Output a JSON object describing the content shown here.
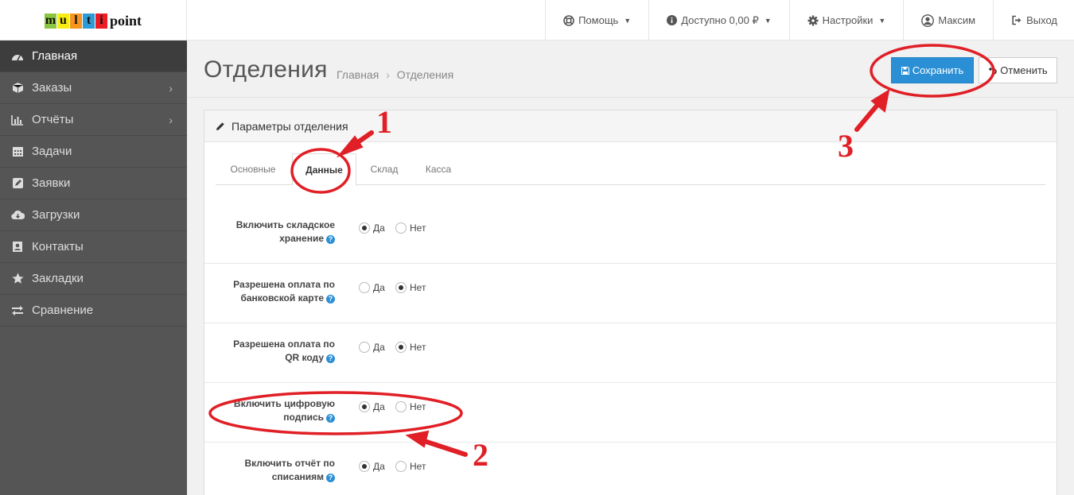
{
  "logo": {
    "letters": [
      "m",
      "u",
      "l",
      "t",
      "i"
    ],
    "letter_colors": [
      "#8cc63f",
      "#f7ec13",
      "#f7941d",
      "#2e9bd6",
      "#ec1c24"
    ],
    "tail": "point"
  },
  "topnav": {
    "help": "Помощь",
    "balance": "Доступно 0,00 ₽",
    "settings": "Настройки",
    "user": "Максим",
    "logout": "Выход"
  },
  "sidebar": {
    "items": [
      {
        "label": "Главная",
        "icon": "dashboard-icon",
        "active": true
      },
      {
        "label": "Заказы",
        "icon": "box-icon",
        "has_arrow": true
      },
      {
        "label": "Отчёты",
        "icon": "bar-chart-icon",
        "has_arrow": true
      },
      {
        "label": "Задачи",
        "icon": "calendar-icon"
      },
      {
        "label": "Заявки",
        "icon": "edit-icon"
      },
      {
        "label": "Загрузки",
        "icon": "cloud-download-icon"
      },
      {
        "label": "Контакты",
        "icon": "contact-icon"
      },
      {
        "label": "Закладки",
        "icon": "star-icon"
      },
      {
        "label": "Сравнение",
        "icon": "exchange-icon"
      }
    ]
  },
  "page": {
    "title": "Отделения",
    "breadcrumb": [
      "Главная",
      "Отделения"
    ],
    "save_label": "Сохранить",
    "cancel_label": "Отменить"
  },
  "panel": {
    "title": "Параметры отделения",
    "tabs": [
      "Основные",
      "Данные",
      "Склад",
      "Касса"
    ],
    "active_tab": "Данные",
    "yes_label": "Да",
    "no_label": "Нет",
    "rows": [
      {
        "label_line1": "Включить складское",
        "label_line2": "хранение",
        "value": "Да"
      },
      {
        "label_line1": "Разрешена оплата по",
        "label_line2": "банковской карте",
        "value": "Нет"
      },
      {
        "label_line1": "Разрешена оплата по",
        "label_line2": "QR коду",
        "value": "Нет"
      },
      {
        "label_line1": "Включить цифровую",
        "label_line2": "подпись",
        "value": "Да"
      },
      {
        "label_line1": "Включить отчёт по",
        "label_line2": "списаниям",
        "value": "Да"
      }
    ]
  },
  "annotations": {
    "n1": "1",
    "n2": "2",
    "n3": "3",
    "color": "#e01f26"
  }
}
